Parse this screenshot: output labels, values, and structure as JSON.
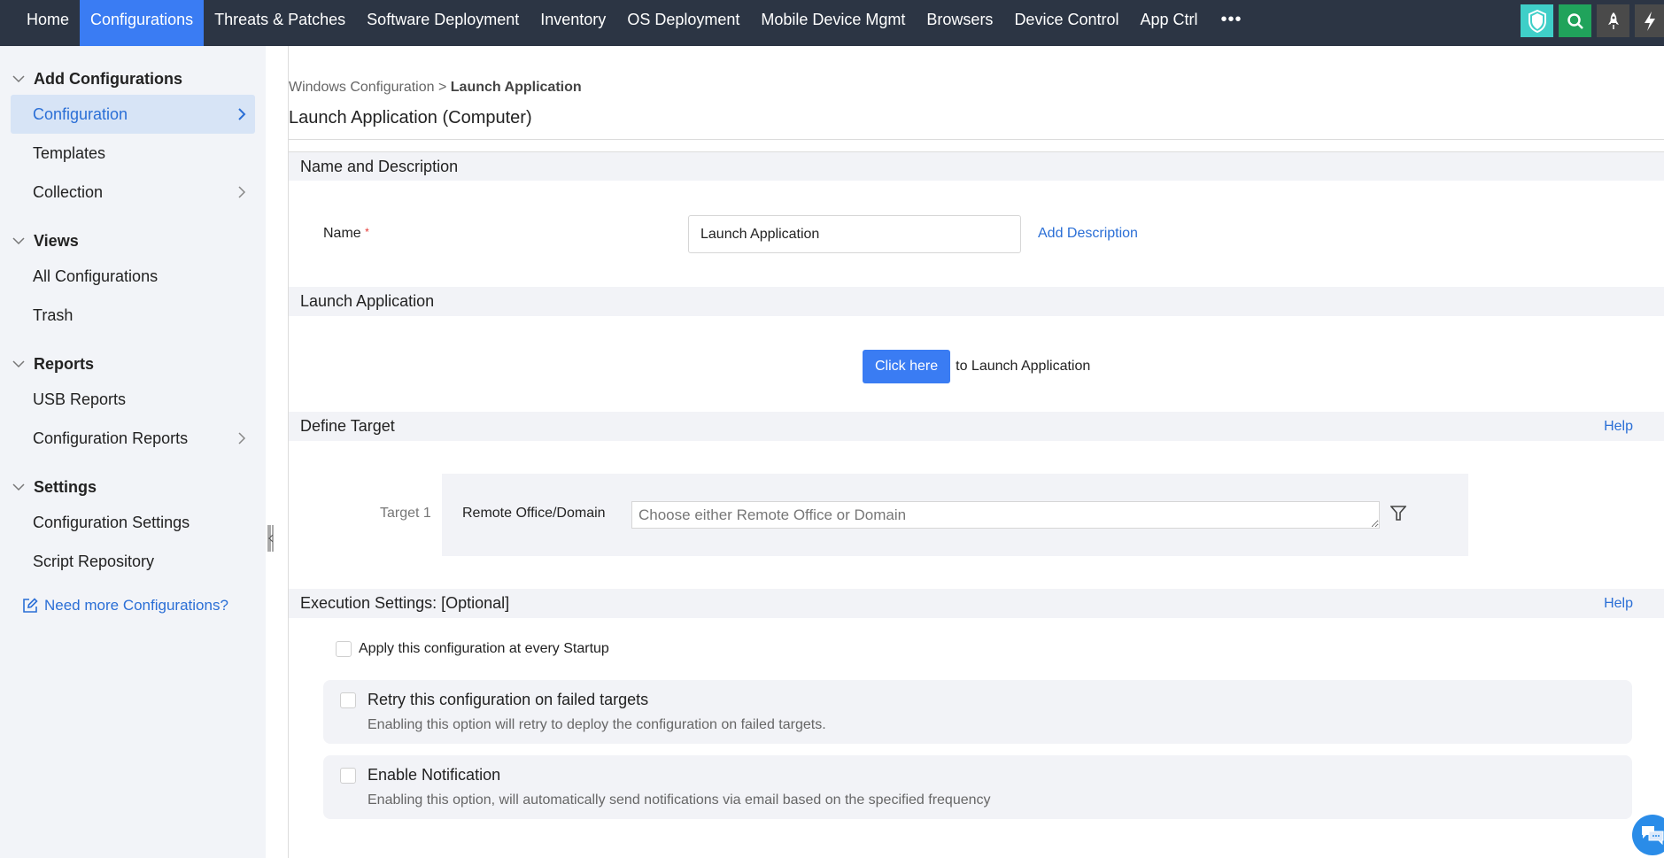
{
  "topnav": {
    "items": [
      {
        "label": "Home",
        "active": false
      },
      {
        "label": "Configurations",
        "active": true
      },
      {
        "label": "Threats & Patches",
        "active": false
      },
      {
        "label": "Software Deployment",
        "active": false
      },
      {
        "label": "Inventory",
        "active": false
      },
      {
        "label": "OS Deployment",
        "active": false
      },
      {
        "label": "Mobile Device Mgmt",
        "active": false
      },
      {
        "label": "Browsers",
        "active": false
      },
      {
        "label": "Device Control",
        "active": false
      },
      {
        "label": "App Ctrl",
        "active": false
      }
    ],
    "more": "•••",
    "icons": [
      "shield-icon",
      "search-icon",
      "rocket-icon",
      "bolt-icon"
    ],
    "colors": {
      "bar": "#2c3544",
      "active": "#3a7cf3",
      "shield": "#3fcfc8",
      "search": "#20a35b",
      "dark": "#4a4a4a"
    }
  },
  "sidebar": {
    "groups": [
      {
        "title": "Add Configurations",
        "items": [
          {
            "label": "Configuration",
            "active": true,
            "has_arrow": true
          },
          {
            "label": "Templates",
            "active": false,
            "has_arrow": false
          },
          {
            "label": "Collection",
            "active": false,
            "has_arrow": true
          }
        ]
      },
      {
        "title": "Views",
        "items": [
          {
            "label": "All Configurations",
            "active": false,
            "has_arrow": false
          },
          {
            "label": "Trash",
            "active": false,
            "has_arrow": false
          }
        ]
      },
      {
        "title": "Reports",
        "items": [
          {
            "label": "USB Reports",
            "active": false,
            "has_arrow": false
          },
          {
            "label": "Configuration Reports",
            "active": false,
            "has_arrow": true
          }
        ]
      },
      {
        "title": "Settings",
        "items": [
          {
            "label": "Configuration Settings",
            "active": false,
            "has_arrow": false
          },
          {
            "label": "Script Repository",
            "active": false,
            "has_arrow": false
          }
        ]
      }
    ],
    "need_more_link": "Need more Configurations?"
  },
  "breadcrumb": {
    "parent": "Windows Configuration",
    "separator": ">",
    "current": "Launch Application"
  },
  "page_title": "Launch Application (Computer)",
  "sections": {
    "name_desc": {
      "header": "Name and Description",
      "name_label": "Name",
      "required_mark": "*",
      "name_value": "Launch Application",
      "add_description": "Add Description"
    },
    "launch": {
      "header": "Launch Application",
      "button": "Click here",
      "suffix": "to Launch Application"
    },
    "target": {
      "header": "Define Target",
      "help": "Help",
      "target_label": "Target 1",
      "field_label": "Remote Office/Domain",
      "placeholder": "Choose either Remote Office or Domain",
      "value": ""
    },
    "execution": {
      "header": "Execution Settings: [Optional]",
      "help": "Help",
      "startup": {
        "label": "Apply this configuration at every Startup",
        "checked": false
      },
      "options": [
        {
          "title": "Retry this configuration on failed targets",
          "desc": "Enabling this option will retry to deploy the configuration on failed targets.",
          "checked": false
        },
        {
          "title": "Enable Notification",
          "desc": "Enabling this option, will automatically send notifications via email based on the specified frequency",
          "checked": false
        }
      ]
    }
  }
}
